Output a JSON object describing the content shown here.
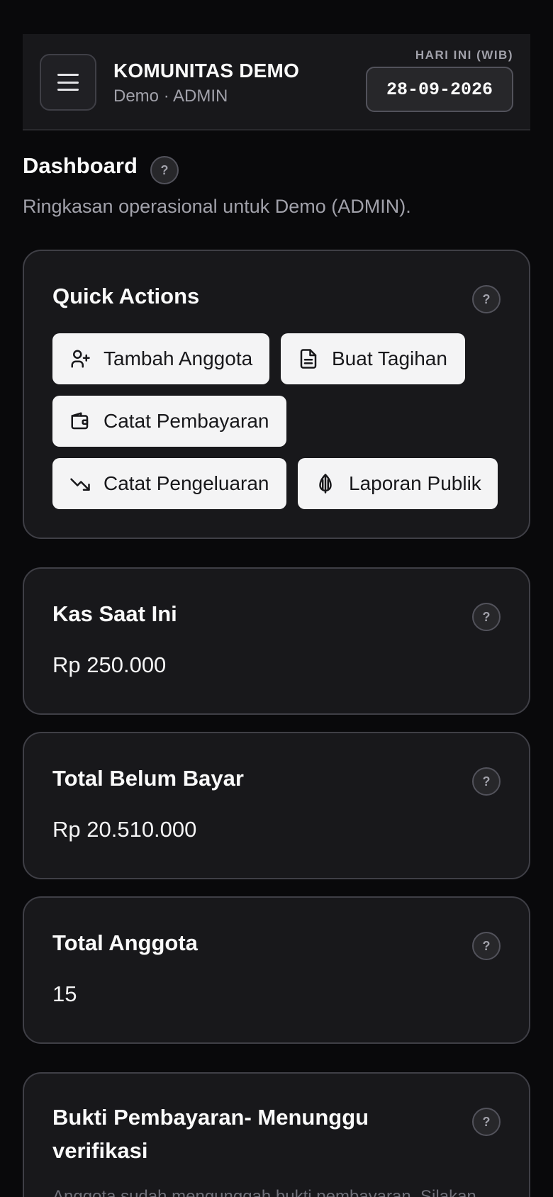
{
  "header": {
    "org_name": "KOMUNITAS DEMO",
    "org_sub": "Demo · ADMIN",
    "today_label": "HARI INI (WIB)",
    "today_date": "28-09-2026",
    "menu_icon": "hamburger-menu-icon"
  },
  "page": {
    "title": "Dashboard",
    "description": "Ringkasan operasional untuk Demo (ADMIN).",
    "help": "?"
  },
  "quick_actions": {
    "title": "Quick Actions",
    "help": "?",
    "buttons": [
      {
        "label": "Tambah Anggota",
        "icon": "user-plus-icon"
      },
      {
        "label": "Buat Tagihan",
        "icon": "file-text-icon"
      },
      {
        "label": "Catat Pembayaran",
        "icon": "wallet-icon"
      },
      {
        "label": "Catat Pengeluaran",
        "icon": "trending-down-icon"
      },
      {
        "label": "Laporan Publik",
        "icon": "public-report-icon"
      }
    ]
  },
  "stats": [
    {
      "title": "Kas Saat Ini",
      "value": "Rp 250.000",
      "help": "?"
    },
    {
      "title": "Total Belum Bayar",
      "value": "Rp 20.510.000",
      "help": "?"
    },
    {
      "title": "Total Anggota",
      "value": "15",
      "help": "?"
    }
  ],
  "pending_proofs": {
    "title": "Bukti Pembayaran- Menunggu verifikasi",
    "help": "?",
    "description": "Anggota sudah mengunggah bukti pembayaran. Silakan"
  },
  "colors": {
    "background": "#09090b",
    "card": "#18181b",
    "border": "#3f3f46",
    "button_bg": "#f4f4f5",
    "muted": "#a1a1aa"
  }
}
